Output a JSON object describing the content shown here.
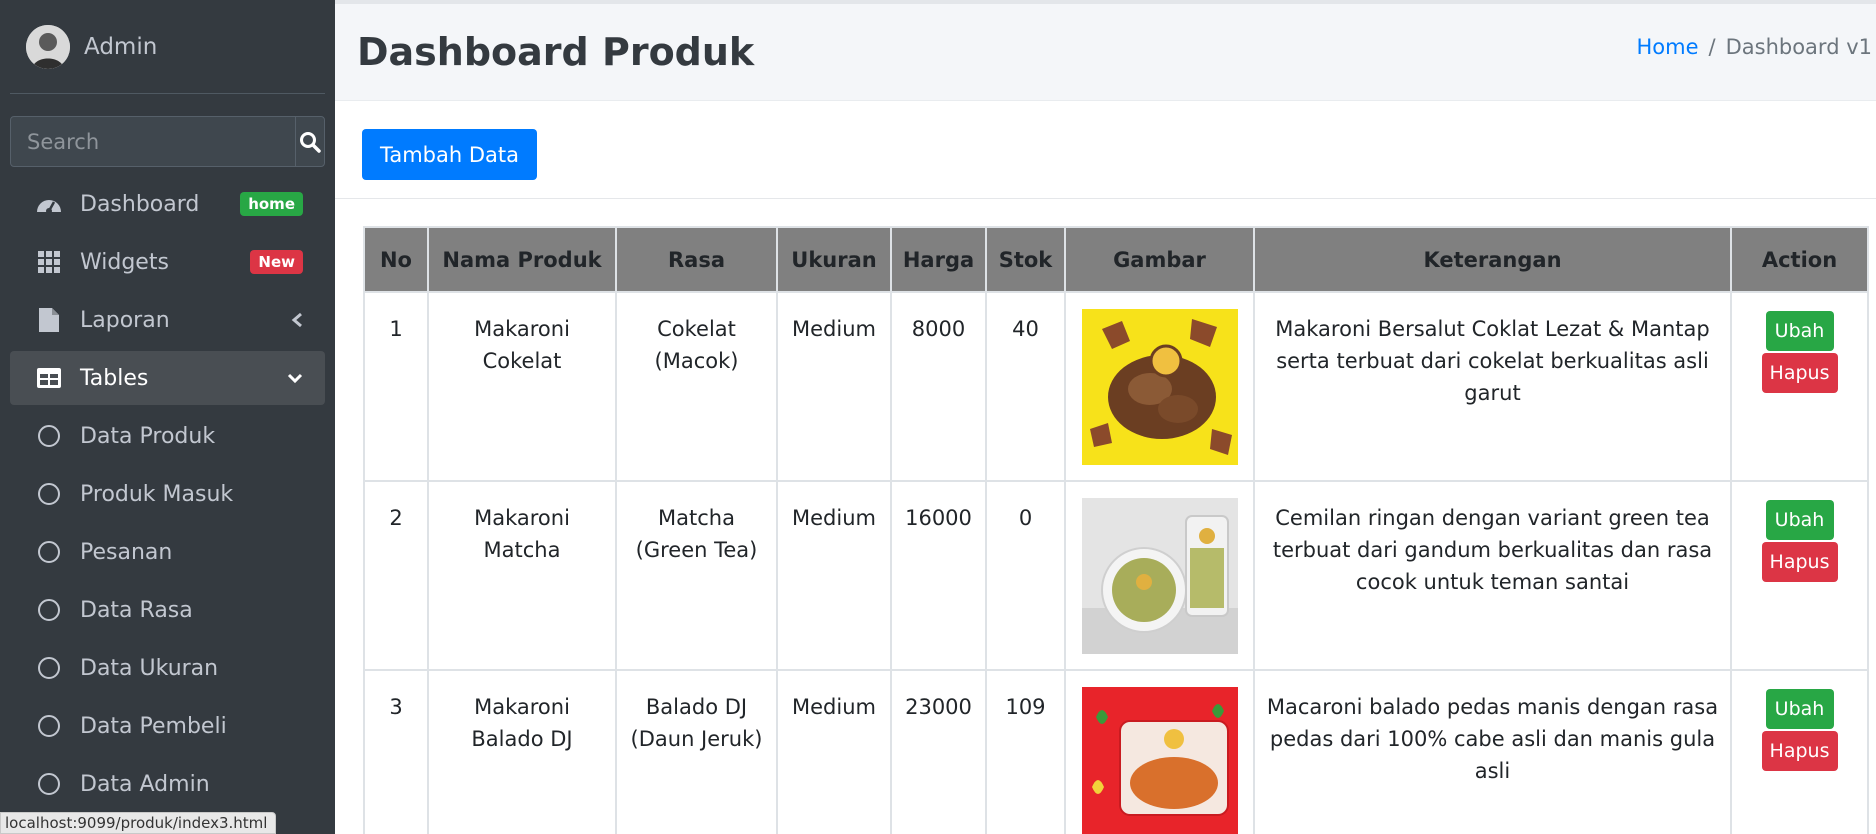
{
  "sidebar": {
    "user_name": "Admin",
    "search_placeholder": "Search",
    "items": [
      {
        "label": "Dashboard",
        "badge": "home",
        "icon": "tachometer-icon"
      },
      {
        "label": "Widgets",
        "badge": "New",
        "icon": "grid-icon"
      },
      {
        "label": "Laporan",
        "icon": "file-icon"
      },
      {
        "label": "Tables",
        "icon": "table-icon"
      }
    ],
    "sub_items": [
      "Data Produk",
      "Produk Masuk",
      "Pesanan",
      "Data Rasa",
      "Data Ukuran",
      "Data Pembeli",
      "Data Admin"
    ]
  },
  "status_bar_url": "localhost:9099/produk/index3.html",
  "header": {
    "title": "Dashboard Produk",
    "breadcrumb_home": "Home",
    "breadcrumb_sep": "/",
    "breadcrumb_current": "Dashboard v1"
  },
  "card": {
    "add_button": "Tambah Data"
  },
  "table": {
    "columns": [
      "No",
      "Nama Produk",
      "Rasa",
      "Ukuran",
      "Harga",
      "Stok",
      "Gambar",
      "Keterangan",
      "Action"
    ],
    "edit_label": "Ubah",
    "delete_label": "Hapus",
    "rows": [
      {
        "no": "1",
        "nama": [
          "Makaroni",
          "Cokelat"
        ],
        "rasa": [
          "Cokelat",
          "(Macok)"
        ],
        "ukuran": "Medium",
        "harga": "8000",
        "stok": "40",
        "keterangan": [
          "Makaroni Bersalut Coklat Lezat & Mantap",
          "serta terbuat dari cokelat berkualitas asli garut"
        ]
      },
      {
        "no": "2",
        "nama": [
          "Makaroni",
          "Matcha"
        ],
        "rasa": [
          "Matcha",
          "(Green Tea)"
        ],
        "ukuran": "Medium",
        "harga": "16000",
        "stok": "0",
        "keterangan": [
          "Cemilan ringan dengan variant green tea",
          "terbuat dari gandum berkualitas dan rasa",
          "cocok untuk teman santai"
        ]
      },
      {
        "no": "3",
        "nama": [
          "Makaroni",
          "Balado DJ"
        ],
        "rasa": [
          "Balado DJ",
          "(Daun Jeruk)"
        ],
        "ukuran": "Medium",
        "harga": "23000",
        "stok": "109",
        "keterangan": [
          "Macaroni balado pedas manis dengan rasa",
          "pedas dari 100% cabe asli dan manis gula asli"
        ]
      }
    ]
  },
  "colors": {
    "sidebar_bg": "#343a40",
    "primary": "#007bff",
    "success": "#28a745",
    "danger": "#dc3545",
    "table_header": "#808080"
  }
}
